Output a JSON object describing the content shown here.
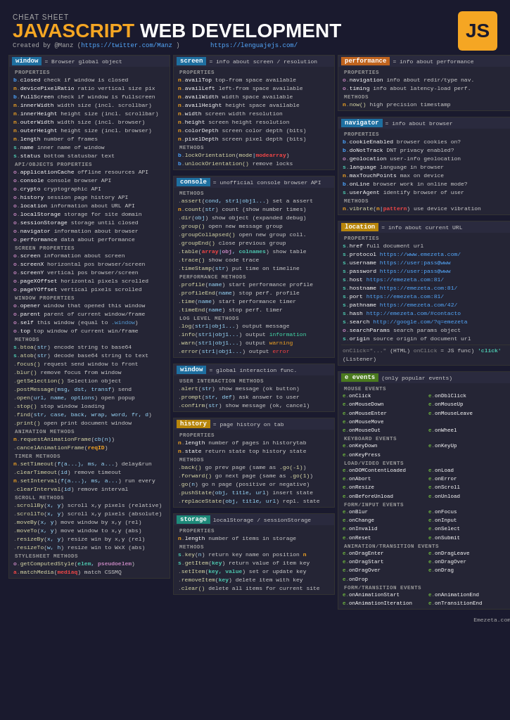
{
  "header": {
    "cheat_label": "CHEAT SHEET",
    "title_part1": "JAVASCRIPT",
    "title_part2": "WEB DEVELOPMENT",
    "created_by": "Created by @Manz (",
    "twitter_link": "https://twitter.com/Manz",
    "twitter_close": " )",
    "website": "https://lenguajejs.com/",
    "js_logo": "JS"
  },
  "footer": {
    "brand": "Emezeta.com"
  }
}
